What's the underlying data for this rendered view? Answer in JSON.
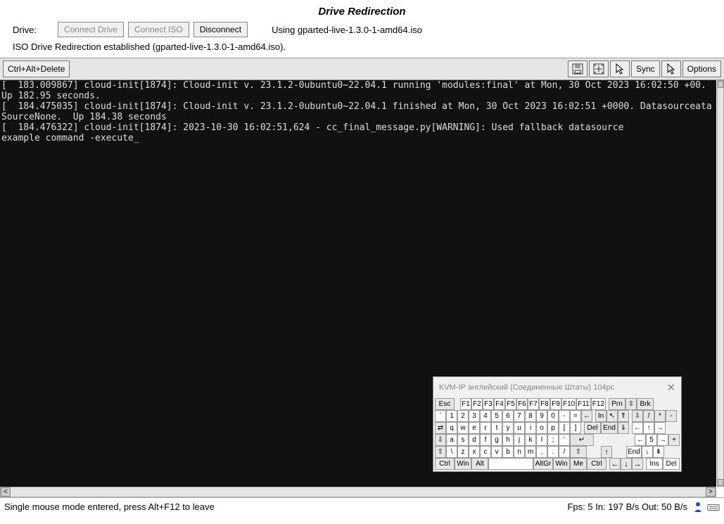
{
  "header": {
    "title": "Drive Redirection",
    "drive_label": "Drive:",
    "connect_drive": "Connect Drive",
    "connect_iso": "Connect ISO",
    "disconnect": "Disconnect",
    "using": "Using gparted-live-1.3.0-1-amd64.iso",
    "status": "ISO Drive Redirection established (gparted-live-1.3.0-1-amd64.iso)."
  },
  "toolbar": {
    "cad": "Ctrl+Alt+Delete",
    "sync": "Sync",
    "options": "Options"
  },
  "console": {
    "lines": "[  183.009867] cloud-init[1874]: Cloud-init v. 23.1.2-0ubuntu0~22.04.1 running 'modules:final' at Mon, 30 Oct 2023 16:02:50 +00. Up 182.95 seconds.\n[  184.475035] cloud-init[1874]: Cloud-init v. 23.1.2-0ubuntu0~22.04.1 finished at Mon, 30 Oct 2023 16:02:51 +0000. DatasourceataSourceNone.  Up 184.38 seconds\n[  184.476322] cloud-init[1874]: 2023-10-30 16:02:51,624 - cc_final_message.py[WARNING]: Used fallback datasource\nexample command -execute_"
  },
  "osk": {
    "title": "KVM-IP английский (Соединенные Штаты) 104pc",
    "close": "✕",
    "rows": {
      "r1": [
        "Esc",
        "F1",
        "F2",
        "F3",
        "F4",
        "F5",
        "F6",
        "F7",
        "F8",
        "F9",
        "F10",
        "F11",
        "F12",
        "Prn",
        "⇳",
        "Brk"
      ],
      "r2": [
        "`",
        "1",
        "2",
        "3",
        "4",
        "5",
        "6",
        "7",
        "8",
        "9",
        "0",
        "-",
        "=",
        "←",
        "In",
        "↖",
        "⇑",
        "⇩",
        "/",
        "*",
        "-"
      ],
      "r3": [
        "⇄",
        "q",
        "w",
        "e",
        "r",
        "t",
        "y",
        "u",
        "i",
        "o",
        "p",
        "[",
        "]",
        "Del",
        "End",
        "⇓",
        "←",
        "↑",
        "→"
      ],
      "r4": [
        "⇩",
        "a",
        "s",
        "d",
        "f",
        "g",
        "h",
        "j",
        "k",
        "l",
        ";",
        "'",
        "↵",
        "←",
        "5",
        "→",
        "+"
      ],
      "r5": [
        "⇧",
        "\\",
        "z",
        "x",
        "c",
        "v",
        "b",
        "n",
        "m",
        ",",
        ".",
        "/",
        "⇧",
        "↑",
        "End",
        "↓",
        "⇟"
      ],
      "r6": [
        "Ctrl",
        "Win",
        "Alt",
        "",
        "AltGr",
        "Win",
        "Me",
        "Ctrl",
        "←",
        "↓",
        "→",
        "Ins",
        "Del"
      ]
    }
  },
  "footer": {
    "left": "Single mouse mode entered, press Alt+F12 to leave",
    "right": "Fps: 5 In: 197 B/s Out: 50 B/s"
  }
}
